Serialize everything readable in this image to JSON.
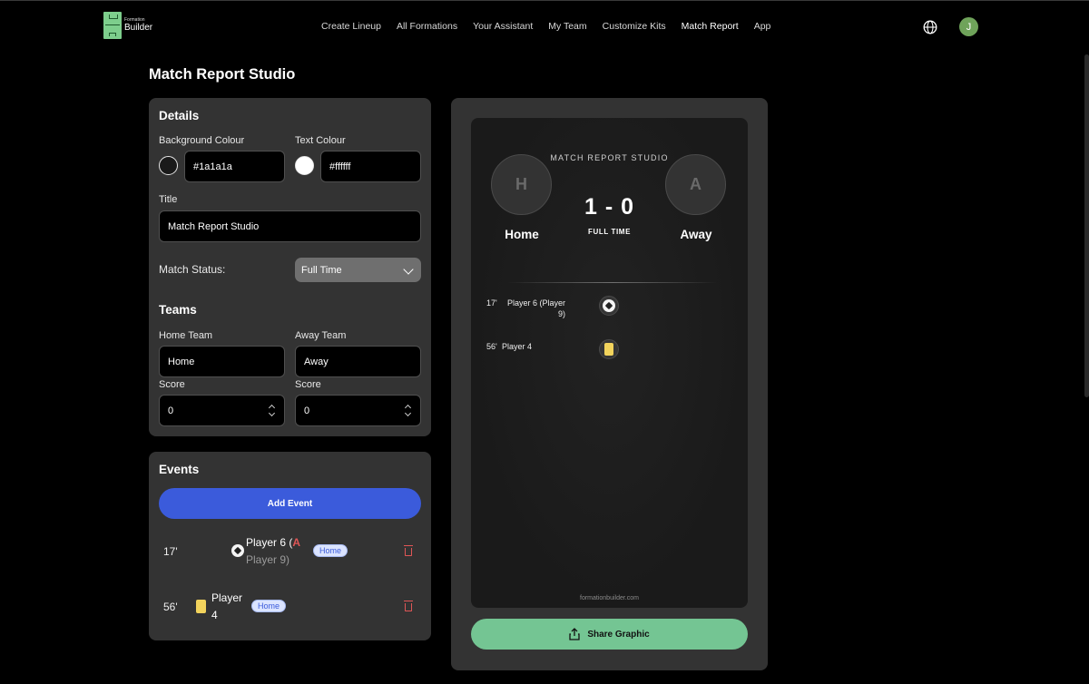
{
  "brand": {
    "small": "Formation",
    "big": "Builder"
  },
  "nav": [
    "Create Lineup",
    "All Formations",
    "Your Assistant",
    "My Team",
    "Customize Kits",
    "Match Report",
    "App"
  ],
  "nav_active": "Match Report",
  "user": {
    "initial": "J",
    "avatar_color": "#6fa35a"
  },
  "page": {
    "title": "Match Report Studio"
  },
  "details": {
    "heading": "Details",
    "bg_label": "Background Colour",
    "bg_value": "#1a1a1a",
    "text_label": "Text Colour",
    "text_value": "#ffffff",
    "title_label": "Title",
    "title_value": "Match Report Studio",
    "status_label": "Match Status:",
    "status_value": "Full Time"
  },
  "teams": {
    "heading": "Teams",
    "home_label": "Home Team",
    "home_value": "Home",
    "away_label": "Away Team",
    "away_value": "Away",
    "home_score_label": "Score",
    "home_score": "0",
    "away_score_label": "Score",
    "away_score": "0"
  },
  "events": {
    "heading": "Events",
    "add_label": "Add Event",
    "items": [
      {
        "minute": "17'",
        "type": "goal-icon",
        "player": "Player 6",
        "open_paren": "(",
        "assist_prefix": "A",
        "assist_player": "Player 9",
        "close_paren": ")",
        "team": "Home"
      },
      {
        "minute": "56'",
        "type": "yellow-card-icon",
        "player_line1": "Player",
        "player_line2": "4",
        "team": "Home"
      }
    ]
  },
  "graphic": {
    "title": "MATCH REPORT STUDIO",
    "home_initial": "H",
    "away_initial": "A",
    "score": "1 - 0",
    "status": "FULL TIME",
    "home_name": "Home",
    "away_name": "Away",
    "events": [
      {
        "minute": "17'",
        "text_line1": "Player 6 (Player",
        "text_line2": "9)"
      },
      {
        "minute": "56'",
        "text": "Player 4"
      }
    ],
    "footer": "formationbuilder.com"
  },
  "share": {
    "label": "Share Graphic"
  },
  "colors": {
    "accent_blue": "#3b5bdb",
    "share_green": "#74c593",
    "danger": "#e05656",
    "card_yellow": "#f2d35c"
  }
}
